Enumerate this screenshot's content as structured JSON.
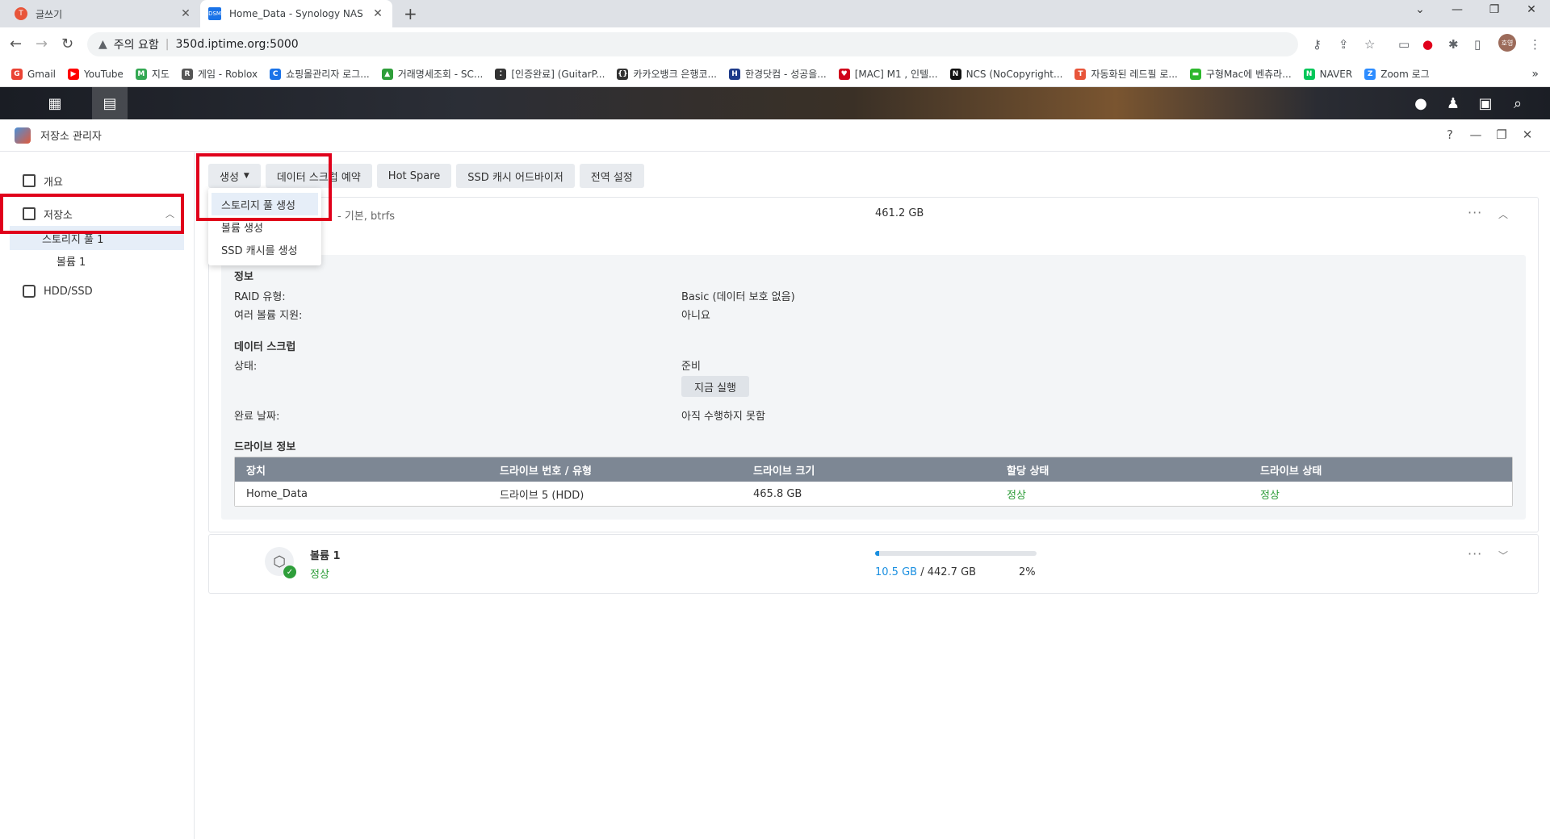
{
  "browser": {
    "tabs": [
      {
        "title": "글쓰기",
        "active": false
      },
      {
        "title": "Home_Data - Synology NAS",
        "active": true
      }
    ],
    "new_tab": "+",
    "address": {
      "security_label": "주의 요함",
      "url": "350d.iptime.org:5000"
    },
    "bookmarks": [
      {
        "label": "Gmail",
        "color": "#ea4335",
        "icon": "G"
      },
      {
        "label": "YouTube",
        "color": "#ff0000",
        "icon": "▶"
      },
      {
        "label": "지도",
        "color": "#34a853",
        "icon": "M"
      },
      {
        "label": "게임 - Roblox",
        "color": "#555555",
        "icon": "R"
      },
      {
        "label": "쇼핑몰관리자 로그...",
        "color": "#1a73e8",
        "icon": "C"
      },
      {
        "label": "거래명세조회 - SC...",
        "color": "#2e9e3a",
        "icon": "▲"
      },
      {
        "label": "[인증완료] (GuitarP...",
        "color": "#333333",
        "icon": "⁚"
      },
      {
        "label": "카카오뱅크 은행코...",
        "color": "#333333",
        "icon": "{}"
      },
      {
        "label": "한경닷컴 - 성공을...",
        "color": "#1d3a8a",
        "icon": "H"
      },
      {
        "label": "[MAC] M1 , 인텔...",
        "color": "#d0021b",
        "icon": "♥"
      },
      {
        "label": "NCS (NoCopyright...",
        "color": "#111111",
        "icon": "N"
      },
      {
        "label": "자동화된 레드필 로...",
        "color": "#e8553a",
        "icon": "T"
      },
      {
        "label": "구형Mac에 벤츄라...",
        "color": "#2eb82e",
        "icon": "▬"
      },
      {
        "label": "NAVER",
        "color": "#03c75a",
        "icon": "N"
      },
      {
        "label": "Zoom 로그",
        "color": "#2d8cff",
        "icon": "Z"
      }
    ],
    "bookmarks_more": "»",
    "avatar_label": "호영"
  },
  "app": {
    "title": "저장소 관리자",
    "help": "?",
    "sidebar": {
      "items": [
        {
          "label": "개요"
        },
        {
          "label": "저장소"
        },
        {
          "label": "스토리지 풀 1"
        },
        {
          "label": "볼륨 1"
        },
        {
          "label": "HDD/SSD"
        }
      ]
    },
    "toolbar": {
      "create": "생성",
      "scrub_schedule": "데이터 스크럽 예약",
      "hot_spare": "Hot Spare",
      "ssd_advisor": "SSD 캐시 어드바이저",
      "global_settings": "전역 설정"
    },
    "create_menu": [
      {
        "label": "스토리지 풀 생성"
      },
      {
        "label": "볼륨 생성"
      },
      {
        "label": "SSD 캐시를 생성"
      }
    ],
    "pool": {
      "subtitle": "- 기본, btrfs",
      "size": "461.2 GB",
      "info_title": "정보",
      "raid_label": "RAID 유형:",
      "raid_value": "Basic (데이터 보호 없음)",
      "multi_volume_label": "여러 볼륨 지원:",
      "multi_volume_value": "아니요",
      "scrub_title": "데이터 스크럽",
      "status_label": "상태:",
      "status_value": "준비",
      "run_now": "지금 실행",
      "completed_label": "완료 날짜:",
      "completed_value": "아직 수행하지 못함",
      "drive_info_title": "드라이브 정보",
      "table": {
        "headers": [
          "장치",
          "드라이브 번호 / 유형",
          "드라이브 크기",
          "할당 상태",
          "드라이브 상태"
        ],
        "rows": [
          [
            "Home_Data",
            "드라이브 5 (HDD)",
            "465.8 GB",
            "정상",
            "정상"
          ]
        ]
      }
    },
    "volume": {
      "name": "볼륨 1",
      "status": "정상",
      "used": "10.5 GB",
      "separator": " / ",
      "total": "442.7 GB",
      "percent": "2%",
      "usage_fraction": 0.024
    }
  },
  "colors": {
    "highlight_box": "#e0001b",
    "status_ok": "#2e9e3a",
    "accent_blue": "#1a8fe0"
  }
}
